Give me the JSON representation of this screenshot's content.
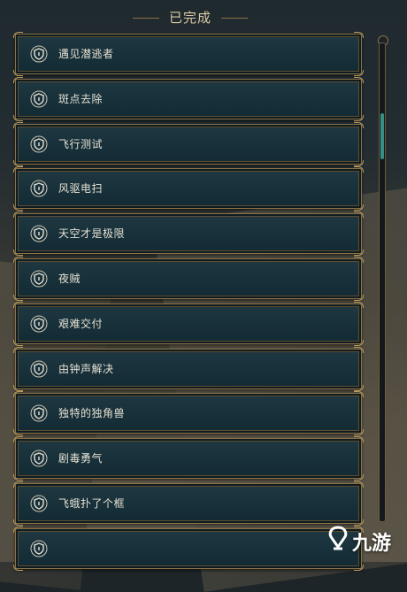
{
  "header": {
    "title": "已完成"
  },
  "quests": [
    {
      "label": "遇见潜逃者",
      "icon": "shield-icon"
    },
    {
      "label": "斑点去除",
      "icon": "shield-icon"
    },
    {
      "label": "飞行测试",
      "icon": "shield-icon"
    },
    {
      "label": "风驱电扫",
      "icon": "shield-icon"
    },
    {
      "label": "天空才是极限",
      "icon": "shield-icon"
    },
    {
      "label": "夜贼",
      "icon": "shield-icon"
    },
    {
      "label": "艰难交付",
      "icon": "shield-icon"
    },
    {
      "label": "由钟声解决",
      "icon": "shield-icon"
    },
    {
      "label": "独特的独角兽",
      "icon": "shield-icon"
    },
    {
      "label": "剧毒勇气",
      "icon": "shield-icon"
    },
    {
      "label": "飞蛾扑了个框",
      "icon": "shield-icon"
    },
    {
      "label": "",
      "icon": "shield-icon"
    }
  ],
  "watermark": {
    "text": "九游"
  },
  "colors": {
    "gold_border": "#8b7348",
    "panel": "#17303a",
    "accent_teal": "#3a9b93",
    "text": "#e6e1d3"
  }
}
